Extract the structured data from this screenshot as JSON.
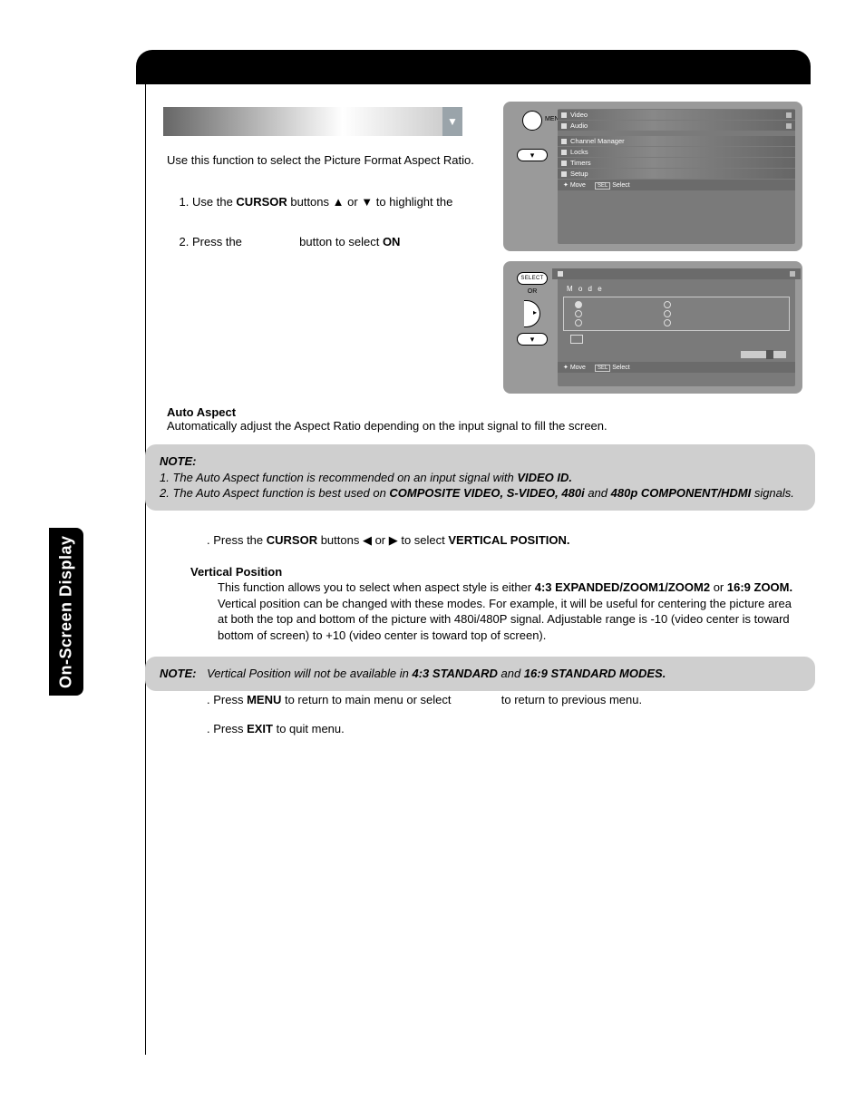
{
  "sideTab": "On-Screen Display",
  "intro": "Use this function to select the Picture Format Aspect Ratio.",
  "steps": {
    "s1_a": "Use the ",
    "s1_b": "CURSOR",
    "s1_c": " buttons ▲ or ▼ to highlight the",
    "s2_a": "Press the ",
    "s2_b": " button to select ",
    "s2_c": "ON"
  },
  "autoAspect": {
    "heading": "Auto Aspect",
    "text": "Automatically adjust the Aspect Ratio depending on the input signal to fill the screen."
  },
  "note1": {
    "label": "NOTE:",
    "l1_a": "1.  The Auto Aspect function is recommended on an input signal with ",
    "l1_b": "VIDEO ID.",
    "l2_a": "2.  The Auto Aspect function is best used on ",
    "l2_b": "COMPOSITE VIDEO, S-VIDEO, 480i",
    "l2_c": " and ",
    "l2_d": "480p COMPONENT/HDMI",
    "l2_e": " signals."
  },
  "cursorStep": {
    "a": ".   Press the ",
    "b": "CURSOR",
    "c": " buttons ◀ or ▶ to select ",
    "d": "VERTICAL POSITION."
  },
  "vp": {
    "heading": "Vertical Position",
    "p_a": "This function allows you to select when aspect style is either ",
    "p_b": "4:3 EXPANDED/ZOOM1/ZOOM2",
    "p_c": " or ",
    "p_d": "16:9 ZOOM.",
    "p_e": " Vertical position can be changed with these modes. For example, it will be useful for centering the picture area at both the top and bottom of the picture with 480i/480P signal. Adjustable range is -10 (video center is toward bottom of screen) to +10 (video center is toward top of screen)."
  },
  "note2": {
    "label": "NOTE:",
    "a": "Vertical Position will not be available in ",
    "b": "4:3 STANDARD",
    "c": " and ",
    "d": "16:9 STANDARD MODES."
  },
  "menuStep": {
    "a": ".   Press ",
    "b": "MENU",
    "c": " to return to main menu or select ",
    "d": " to return to previous menu."
  },
  "exitStep": {
    "a": ".   Press ",
    "b": "EXIT",
    "c": " to quit menu."
  },
  "osd1": {
    "menuLabel": "MENU",
    "items": [
      "Video",
      "Audio",
      "",
      "Channel Manager",
      "Locks",
      "Timers",
      "Setup"
    ],
    "footer_move": "Move",
    "footer_sel": "SEL",
    "footer_select": "Select"
  },
  "osd2": {
    "selLabel": "SELECT",
    "or": "OR",
    "modeTitle": "M o d e",
    "footer_move": "Move",
    "footer_sel": "SEL",
    "footer_select": "Select"
  }
}
